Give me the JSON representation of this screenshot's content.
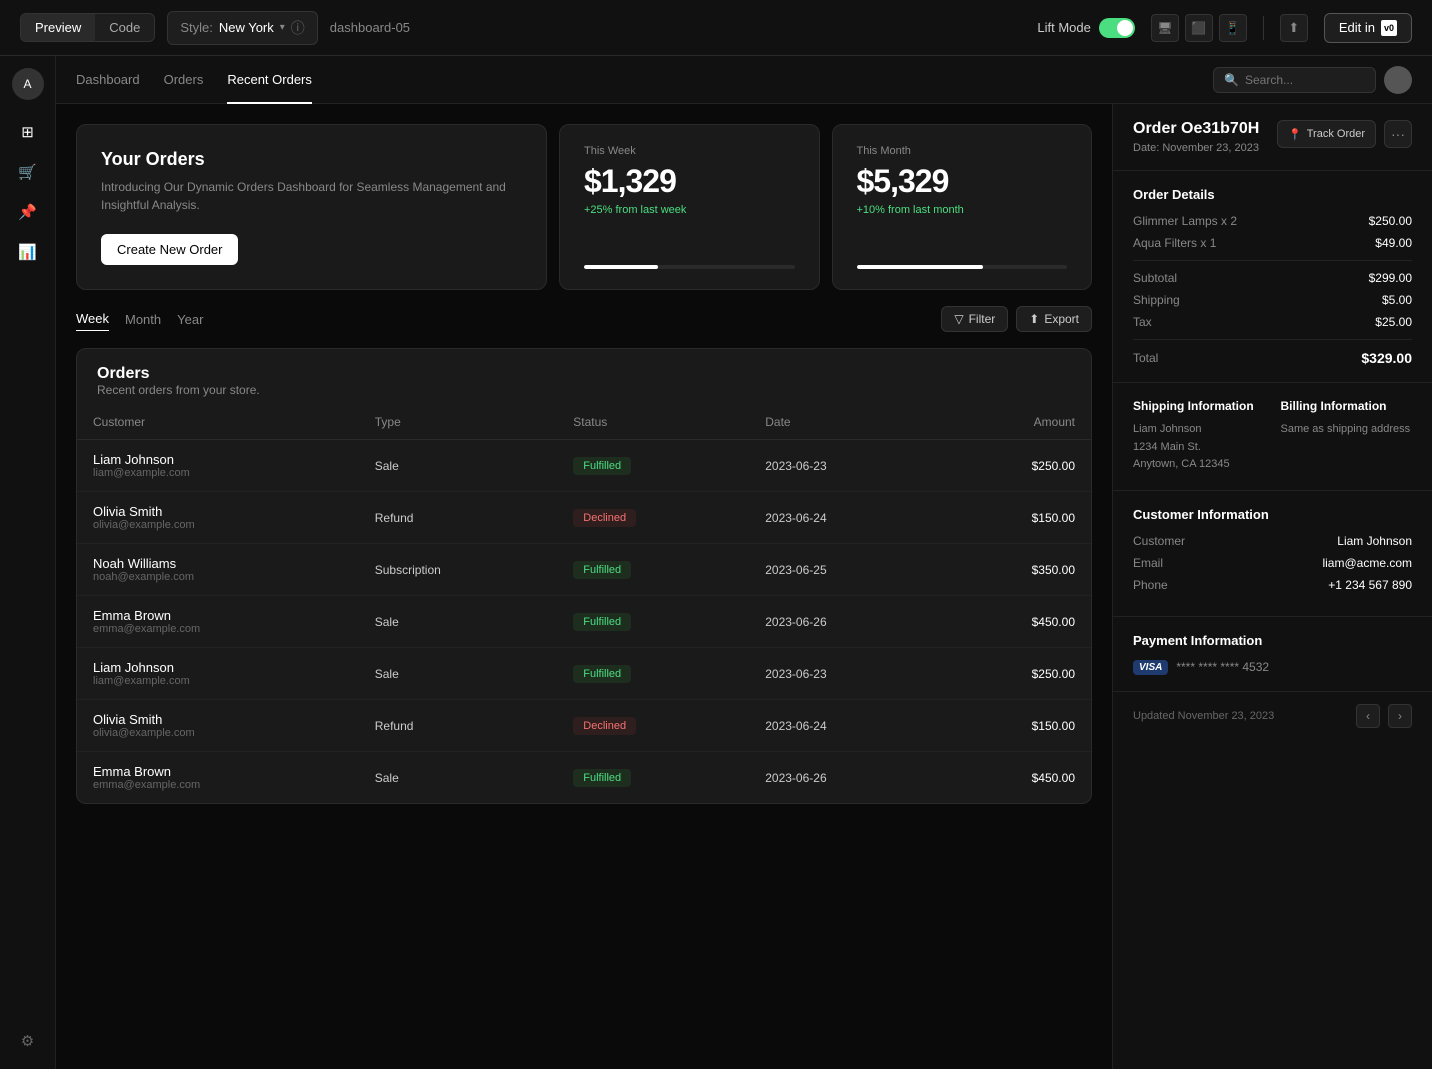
{
  "toolbar": {
    "preview_label": "Preview",
    "code_label": "Code",
    "style_prefix": "Style:",
    "style_value": "New York",
    "dashboard_id": "dashboard-05",
    "lift_mode_label": "Lift Mode",
    "edit_label": "Edit in",
    "v0_label": "v0"
  },
  "subnav": {
    "items": [
      {
        "label": "Dashboard",
        "active": false
      },
      {
        "label": "Orders",
        "active": false
      },
      {
        "label": "Recent Orders",
        "active": true
      }
    ],
    "search_placeholder": "Search..."
  },
  "hero": {
    "title": "Your Orders",
    "description": "Introducing Our Dynamic Orders Dashboard for Seamless Management and Insightful Analysis.",
    "cta_label": "Create New Order"
  },
  "stats": {
    "this_week": {
      "label": "This Week",
      "value": "$1,329",
      "change": "+25% from last week",
      "progress": 35
    },
    "this_month": {
      "label": "This Month",
      "value": "$5,329",
      "change": "+10% from last month",
      "progress": 60
    }
  },
  "period_tabs": [
    "Week",
    "Month",
    "Year"
  ],
  "filter_label": "Filter",
  "export_label": "Export",
  "orders": {
    "title": "Orders",
    "subtitle": "Recent orders from your store.",
    "columns": [
      "Customer",
      "Type",
      "Status",
      "Date",
      "Amount"
    ],
    "rows": [
      {
        "name": "Liam Johnson",
        "email": "liam@example.com",
        "type": "Sale",
        "status": "Fulfilled",
        "status_type": "fulfilled",
        "date": "2023-06-23",
        "amount": "$250.00"
      },
      {
        "name": "Olivia Smith",
        "email": "olivia@example.com",
        "type": "Refund",
        "status": "Declined",
        "status_type": "declined",
        "date": "2023-06-24",
        "amount": "$150.00"
      },
      {
        "name": "Noah Williams",
        "email": "noah@example.com",
        "type": "Subscription",
        "status": "Fulfilled",
        "status_type": "fulfilled",
        "date": "2023-06-25",
        "amount": "$350.00"
      },
      {
        "name": "Emma Brown",
        "email": "emma@example.com",
        "type": "Sale",
        "status": "Fulfilled",
        "status_type": "fulfilled",
        "date": "2023-06-26",
        "amount": "$450.00"
      },
      {
        "name": "Liam Johnson",
        "email": "liam@example.com",
        "type": "Sale",
        "status": "Fulfilled",
        "status_type": "fulfilled",
        "date": "2023-06-23",
        "amount": "$250.00"
      },
      {
        "name": "Olivia Smith",
        "email": "olivia@example.com",
        "type": "Refund",
        "status": "Declined",
        "status_type": "declined",
        "date": "2023-06-24",
        "amount": "$150.00"
      },
      {
        "name": "Emma Brown",
        "email": "emma@example.com",
        "type": "Sale",
        "status": "Fulfilled",
        "status_type": "fulfilled",
        "date": "2023-06-26",
        "amount": "$450.00"
      }
    ]
  },
  "order_detail": {
    "id": "Order Oe31b70H",
    "date": "Date: November 23, 2023",
    "track_label": "Track Order",
    "details_title": "Order Details",
    "items": [
      {
        "name": "Glimmer Lamps x 2",
        "price": "$250.00"
      },
      {
        "name": "Aqua Filters x 1",
        "price": "$49.00"
      }
    ],
    "subtotal_label": "Subtotal",
    "subtotal": "$299.00",
    "shipping_label": "Shipping",
    "shipping": "$5.00",
    "tax_label": "Tax",
    "tax": "$25.00",
    "total_label": "Total",
    "total": "$329.00",
    "shipping_info_title": "Shipping Information",
    "shipping_name": "Liam Johnson",
    "shipping_address": "1234 Main St.\nAnytown, CA 12345",
    "billing_info_title": "Billing Information",
    "billing_text": "Same as shipping address",
    "customer_title": "Customer Information",
    "customer_label": "Customer",
    "customer_name": "Liam Johnson",
    "email_label": "Email",
    "customer_email": "liam@acme.com",
    "phone_label": "Phone",
    "customer_phone": "+1 234 567 890",
    "payment_title": "Payment Information",
    "card_brand": "Visa",
    "card_number": "**** **** **** 4532",
    "updated_label": "Updated November 23, 2023"
  }
}
